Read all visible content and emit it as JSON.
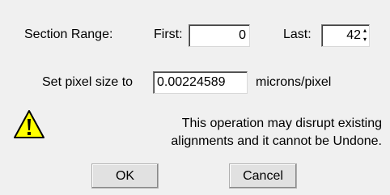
{
  "section_range": {
    "label": "Section Range:",
    "first_label": "First:",
    "first_value": "0",
    "last_label": "Last:",
    "last_value": "42"
  },
  "pixel_size": {
    "label": "Set pixel size to",
    "value": "0.00224589",
    "units": "microns/pixel"
  },
  "warning": {
    "icon": "warning-icon",
    "line1": "This operation may disrupt existing",
    "line2": "alignments and it cannot be Undone."
  },
  "buttons": {
    "ok_label": "OK",
    "cancel_label": "Cancel"
  },
  "colors": {
    "dialog_bg": "#f0f0f0",
    "warning_yellow": "#ffff00"
  }
}
